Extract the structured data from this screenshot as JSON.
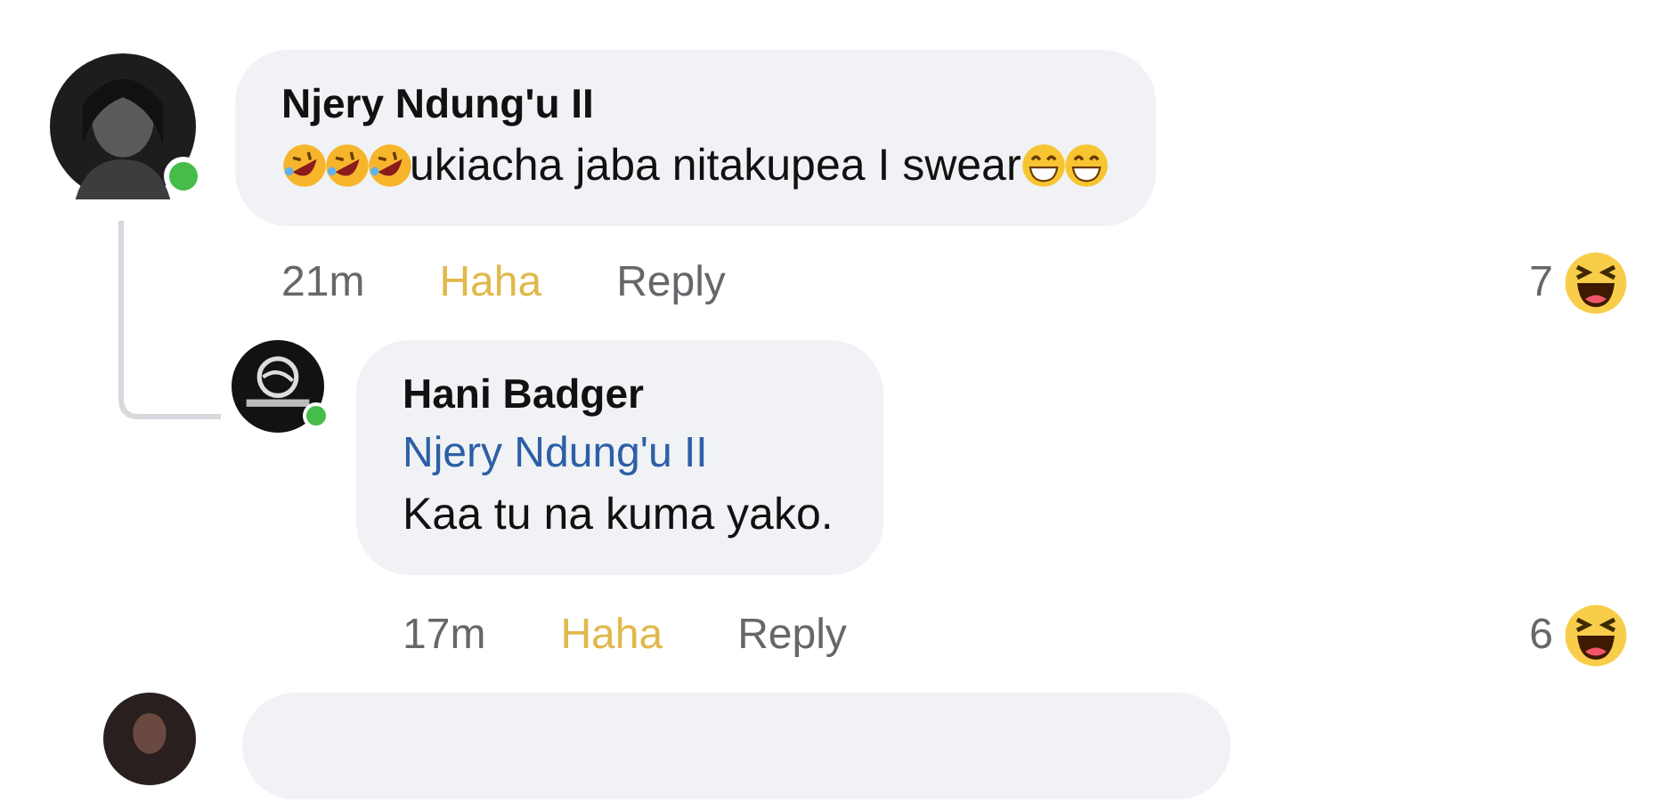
{
  "comments": [
    {
      "author": "Njery Ndung'u II",
      "online": true,
      "body": [
        {
          "kind": "rofl_emoji"
        },
        {
          "kind": "rofl_emoji"
        },
        {
          "kind": "rofl_emoji"
        },
        {
          "kind": "text",
          "text": "ukiacha jaba nitakupea I swear"
        },
        {
          "kind": "grin_emoji"
        },
        {
          "kind": "grin_emoji"
        }
      ],
      "time": "21m",
      "reaction_label": "Haha",
      "reacted": true,
      "reply_label": "Reply",
      "reaction_count": "7"
    },
    {
      "author": "Hani Badger",
      "online": true,
      "mention": "Njery Ndung'u II",
      "body": [
        {
          "kind": "text",
          "text": "Kaa tu na kuma yako."
        }
      ],
      "time": "17m",
      "reaction_label": "Haha",
      "reacted": true,
      "reply_label": "Reply",
      "reaction_count": "6"
    }
  ]
}
